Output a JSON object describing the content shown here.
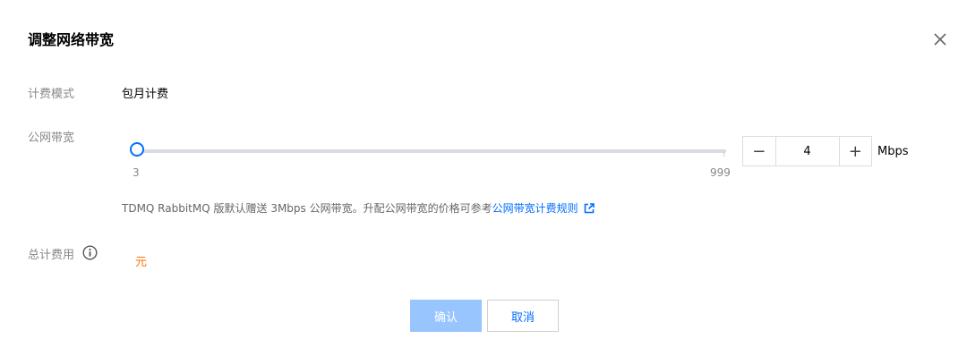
{
  "dialog": {
    "title": "调整网络带宽",
    "close_icon": "close-icon"
  },
  "billing_mode": {
    "label": "计费模式",
    "value": "包月计费"
  },
  "bandwidth": {
    "label": "公网带宽",
    "min_label": "3",
    "max_label": "999",
    "min": 3,
    "max": 999,
    "current": "4",
    "unit": "Mbps",
    "minus_glyph": "−",
    "plus_glyph": "+",
    "hint_text": "TDMQ RabbitMQ 版默认赠送 3Mbps 公网带宽。升配公网带宽的价格可参考",
    "hint_link": "公网带宽计费规则",
    "hint_link_icon": "external-link-icon"
  },
  "total_cost": {
    "label": "总计费用",
    "info_icon": "info-icon",
    "currency": "元"
  },
  "footer": {
    "confirm_label": "确认",
    "cancel_label": "取消"
  },
  "colors": {
    "primary": "#006eff",
    "confirm_disabled": "#99c5ff",
    "price": "#ff7200"
  }
}
